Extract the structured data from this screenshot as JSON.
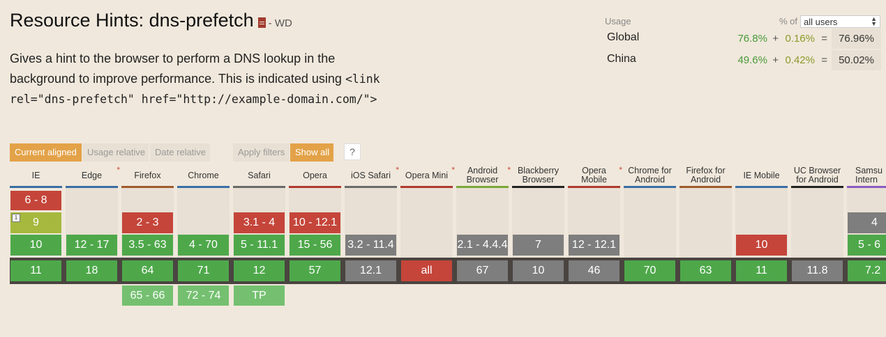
{
  "feature": {
    "title": "Resource Hints: dns-prefetch",
    "status": "- WD",
    "description_text": "Gives a hint to the browser to perform a DNS lookup in the background to improve performance. This is indicated using",
    "description_code": "<link rel=\"dns-prefetch\" href=\"http://example-domain.com/\">"
  },
  "usage": {
    "label": "Usage",
    "pct_of_label": "% of",
    "user_scope": "all users",
    "rows": [
      {
        "name": "Global",
        "supported": "76.8%",
        "plus": "+",
        "partial": "0.16%",
        "eq": "=",
        "total": "76.96%"
      },
      {
        "name": "China",
        "supported": "49.6%",
        "plus": "+",
        "partial": "0.42%",
        "eq": "=",
        "total": "50.02%"
      }
    ]
  },
  "filters": {
    "current_aligned": "Current aligned",
    "usage_relative": "Usage relative",
    "date_relative": "Date relative",
    "apply_filters": "Apply filters",
    "show_all": "Show all",
    "help": "?"
  },
  "browsers": {
    "ie": {
      "name": "IE",
      "color": "#3a6ea5"
    },
    "edge": {
      "name": "Edge",
      "color": "#3a6ea5",
      "note": "*"
    },
    "firefox": {
      "name": "Firefox",
      "color": "#a05a2c"
    },
    "chrome": {
      "name": "Chrome",
      "color": "#3a6ea5"
    },
    "safari": {
      "name": "Safari",
      "color": "#6a6a6a"
    },
    "opera": {
      "name": "Opera",
      "color": "#b03a2e"
    },
    "ios_safari": {
      "name": "iOS Safari",
      "color": "#6a6a6a",
      "note": "*"
    },
    "opera_mini": {
      "name": "Opera Mini",
      "color": "#b03a2e",
      "note": "*"
    },
    "android": {
      "name_line1": "Android",
      "name_line2": "Browser",
      "color": "#7aa83a",
      "note": "*"
    },
    "blackberry": {
      "name_line1": "Blackberry",
      "name_line2": "Browser",
      "color": "#222222"
    },
    "opera_mobile": {
      "name": "Opera Mobile",
      "color": "#b03a2e",
      "note": "*"
    },
    "chrome_android": {
      "name_line1": "Chrome for",
      "name_line2": "Android",
      "color": "#3a6ea5"
    },
    "firefox_android": {
      "name_line1": "Firefox for",
      "name_line2": "Android",
      "color": "#a05a2c"
    },
    "ie_mobile": {
      "name": "IE Mobile",
      "color": "#3a6ea5"
    },
    "uc_browser": {
      "name_line1": "UC Browser",
      "name_line2": "for Android",
      "color": "#222222"
    },
    "samsung": {
      "name_line1": "Samsu",
      "name_line2": "Intern",
      "color": "#8a5ac0"
    }
  },
  "versions": {
    "ie": {
      "r1": "6 - 8",
      "r2": "9",
      "r3": "10",
      "cur": "11",
      "r2_note": "1"
    },
    "edge": {
      "r3": "12 - 17",
      "cur": "18"
    },
    "firefox": {
      "r2": "2 - 3",
      "r3": "3.5 - 63",
      "cur": "64",
      "fut": "65 - 66"
    },
    "chrome": {
      "r3": "4 - 70",
      "cur": "71",
      "fut": "72 - 74"
    },
    "safari": {
      "r2": "3.1 - 4",
      "r3": "5 - 11.1",
      "cur": "12",
      "fut": "TP"
    },
    "opera": {
      "r2": "10 - 12.1",
      "r3": "15 - 56",
      "cur": "57"
    },
    "ios_safari": {
      "r3": "3.2 - 11.4",
      "cur": "12.1"
    },
    "opera_mini": {
      "cur": "all"
    },
    "android": {
      "r3": "2.1 - 4.4.4",
      "cur": "67"
    },
    "blackberry": {
      "r3": "7",
      "cur": "10"
    },
    "opera_mobile": {
      "r3": "12 - 12.1",
      "cur": "46"
    },
    "chrome_android": {
      "cur": "70"
    },
    "firefox_android": {
      "cur": "63"
    },
    "ie_mobile": {
      "r3": "10",
      "cur": "11"
    },
    "uc_browser": {
      "cur": "11.8"
    },
    "samsung": {
      "r2": "4",
      "r3": "5 - 6",
      "cur": "7.2"
    }
  },
  "colors": {
    "supported": "#4ea84a",
    "partial": "#a6b93e",
    "unsupported": "#c5453a",
    "unknown": "#7e7e7e",
    "future_supported": "#74c070",
    "accent": "#e3a248"
  }
}
